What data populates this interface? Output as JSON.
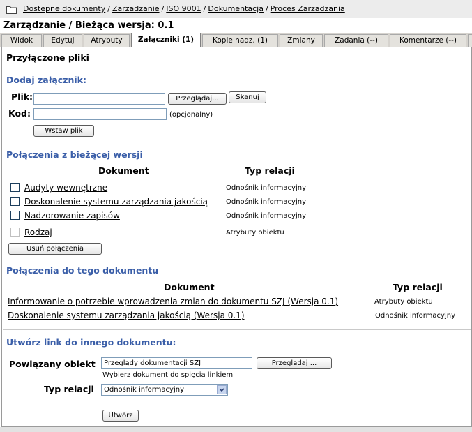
{
  "breadcrumb": {
    "items": [
      "Dostepne dokumenty",
      "Zarzadzanie",
      "ISO 9001",
      "Dokumentacja",
      "Proces Zarzadzania"
    ],
    "separator": "/"
  },
  "page_title": "Zarządzanie / Bieżąca wersja: 0.1",
  "tabs": [
    {
      "label": "Widok"
    },
    {
      "label": "Edytuj"
    },
    {
      "label": "Atrybuty"
    },
    {
      "label": "Załączniki (1)"
    },
    {
      "label": "Kopie nadz. (1)"
    },
    {
      "label": "Zmiany"
    },
    {
      "label": "Zadania (--)"
    },
    {
      "label": "Komentarze (--)"
    }
  ],
  "attached": {
    "heading": "Przyłączone pliki"
  },
  "add_attachment": {
    "heading": "Dodaj załącznik:",
    "file_label": "Plik:",
    "file_value": "",
    "browse_label": "Przeglądaj...",
    "scan_label": "Skanuj",
    "code_label": "Kod:",
    "code_value": "",
    "code_hint": "(opcjonalny)",
    "insert_label": "Wstaw plik"
  },
  "links_from": {
    "heading": "Połączenia z bieżącej wersji",
    "col_document": "Dokument",
    "col_relation": "Typ relacji",
    "rows": [
      {
        "doc": "Audyty wewnętrzne",
        "rel": "Odnośnik informacyjny",
        "checkbox_enabled": true
      },
      {
        "doc": "Doskonalenie systemu zarządzania jakością",
        "rel": "Odnośnik informacyjny",
        "checkbox_enabled": true
      },
      {
        "doc": "Nadzorowanie zapisów",
        "rel": "Odnośnik informacyjny",
        "checkbox_enabled": true
      },
      {
        "doc": "Rodzaj",
        "rel": "Atrybuty obiektu",
        "checkbox_enabled": false
      }
    ],
    "remove_label": "Usuń połączenia"
  },
  "links_to": {
    "heading": "Połączenia do tego dokumentu",
    "col_document": "Dokument",
    "col_relation": "Typ relacji",
    "rows": [
      {
        "doc": "Informowanie o potrzebie wprowadzenia zmian do dokumentu SZJ (Wersja 0.1)",
        "rel": "Atrybuty obiektu"
      },
      {
        "doc": "Doskonalenie systemu zarządzania jakością (Wersja 0.1)",
        "rel": "Odnośnik informacyjny"
      }
    ]
  },
  "create_link": {
    "heading": "Utwórz link do innego dokumentu:",
    "related_label": "Powiązany obiekt",
    "related_value": "Przeglądy dokumentacji SZJ",
    "browse_label": "Przeglądaj ...",
    "hint": "Wybierz dokument do spięcia linkiem",
    "relation_label": "Typ relacji",
    "relation_value": "Odnośnik informacyjny",
    "create_label": "Utwórz"
  },
  "colors": {
    "section_heading": "#3a5ea8",
    "crumb_bar": "#ececec",
    "tab_bar": "#d6d3ce"
  }
}
